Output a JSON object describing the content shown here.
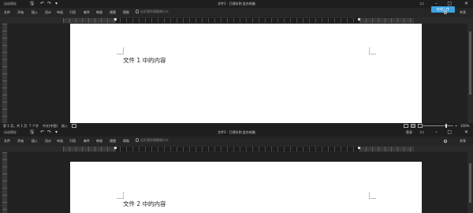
{
  "windows": [
    {
      "autosave_label": "自动保存",
      "title": "文件1 - 已保存到 此台电脑",
      "tabs": [
        "文件",
        "开始",
        "插入",
        "设计",
        "布局",
        "引用",
        "邮件",
        "审阅",
        "视图",
        "帮助"
      ],
      "tell_me": "告诉我你想要做什么",
      "share_label": "共享",
      "online_badge": "在线上传",
      "body_text": "文件 1 中的内容",
      "status": {
        "page": "第 1 页，共 1 页",
        "words": "7 个字",
        "language": "中文(中国)",
        "mode": "插入",
        "zoom": "100%"
      }
    },
    {
      "autosave_label": "自动保存",
      "title": "文件2 - 已保存到 此台电脑",
      "login_label": "登录",
      "tabs": [
        "文件",
        "开始",
        "插入",
        "设计",
        "布局",
        "引用",
        "邮件",
        "审阅",
        "视图",
        "帮助"
      ],
      "tell_me": "告诉我你想要做什么",
      "share_label": "共享",
      "body_text": "文件 2 中的内容"
    }
  ],
  "icons": [
    "save-icon",
    "undo-icon",
    "redo-icon",
    "bulb-icon",
    "share-icon",
    "minimize-icon",
    "maximize-icon",
    "close-icon"
  ]
}
